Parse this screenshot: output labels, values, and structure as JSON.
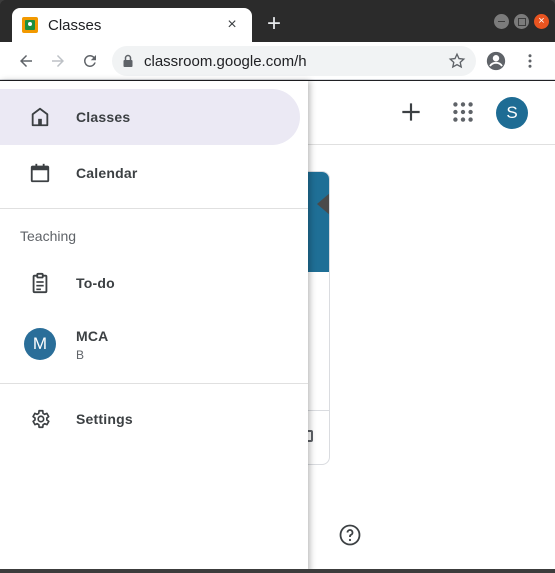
{
  "browser": {
    "tab_title": "Classes",
    "tab_close": "×",
    "new_tab": "+",
    "url": "classroom.google.com/h",
    "window_close": "×"
  },
  "header": {
    "avatar_letter": "S"
  },
  "drawer": {
    "items": [
      {
        "label": "Classes",
        "icon": "home-icon",
        "active": true
      },
      {
        "label": "Calendar",
        "icon": "calendar-icon",
        "active": false
      }
    ],
    "teaching_section": "Teaching",
    "todo_label": "To-do",
    "class": {
      "avatar_letter": "M",
      "name": "MCA",
      "section": "B"
    },
    "settings_label": "Settings"
  },
  "colors": {
    "active_nav_bg": "#ebe9f4",
    "avatar_blue": "#1e6c94",
    "close_orange": "#e95420"
  }
}
